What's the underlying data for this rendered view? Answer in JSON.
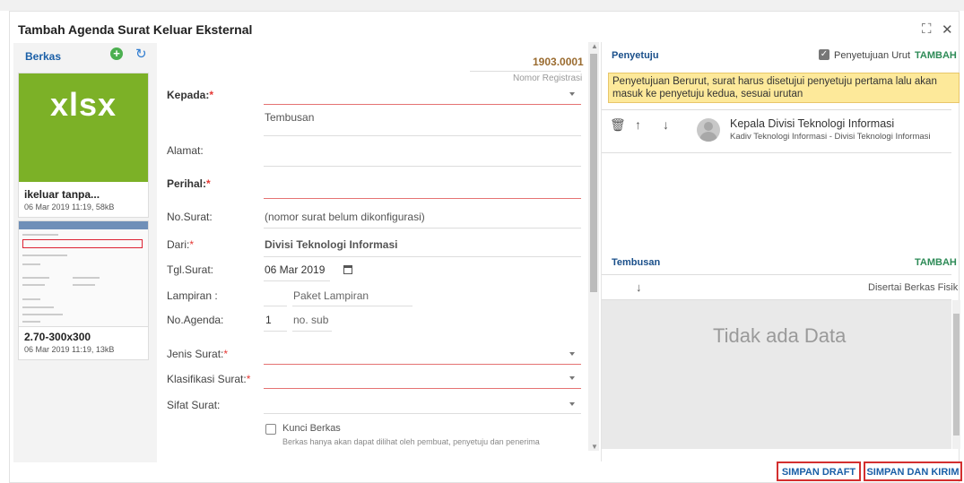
{
  "dialog": {
    "title": "Tambah Agenda Surat Keluar Eksternal",
    "expand_icon": "expand-icon",
    "close_icon": "close-icon"
  },
  "berkas": {
    "title": "Berkas",
    "files": [
      {
        "thumb_text": "xlsx",
        "name": "ikeluar tanpa...",
        "meta": "06 Mar 2019 11:19, 58kB"
      },
      {
        "thumb_text": "",
        "name": "2.70-300x300",
        "meta": "06 Mar 2019 11:19, 13kB"
      }
    ]
  },
  "form": {
    "nomor_registrasi_value": "1903.0001",
    "nomor_registrasi_label": "Nomor Registrasi",
    "kepada_label": "Kepada:",
    "tembusan_placeholder": "Tembusan",
    "alamat_label": "Alamat:",
    "perihal_label": "Perihal:",
    "no_surat_label": "No.Surat:",
    "no_surat_value": "(nomor surat belum dikonfigurasi)",
    "dari_label": "Dari:",
    "dari_value": "Divisi Teknologi Informasi",
    "tgl_surat_label": "Tgl.Surat:",
    "tgl_surat_value": "06 Mar 2019",
    "lampiran_label": "Lampiran :",
    "lampiran_placeholder": "Paket Lampiran",
    "no_agenda_label": "No.Agenda:",
    "no_agenda_value": "1",
    "no_sub_placeholder": "no. sub",
    "jenis_surat_label": "Jenis Surat:",
    "klasifikasi_label": "Klasifikasi Surat:",
    "sifat_surat_label": "Sifat Surat:",
    "kunci_berkas_label": "Kunci Berkas",
    "kunci_berkas_hint": "Berkas hanya akan dapat dilihat oleh pembuat, penyetuju dan penerima",
    "required_mark": "*"
  },
  "penyetuju": {
    "title": "Penyetuju",
    "urut_label": "Penyetujuan Urut",
    "urut_checked": true,
    "tambah_label": "TAMBAH",
    "note": "Penyetujuan Berurut, surat harus disetujui penyetuju pertama lalu akan masuk ke penyetuju kedua, sesuai urutan",
    "items": [
      {
        "name": "Kepala Divisi Teknologi Informasi",
        "role": "Kadiv Teknologi Informasi - Divisi Teknologi Informasi"
      }
    ]
  },
  "tembusan": {
    "title": "Tembusan",
    "tambah_label": "TAMBAH",
    "col_disertai": "Disertai Berkas Fisik",
    "empty_text": "Tidak ada Data"
  },
  "actions": {
    "simpan_draft": "SIMPAN DRAFT",
    "simpan_kirim": "SIMPAN DAN KIRIM"
  },
  "colors": {
    "accent_blue": "#1a5fa7",
    "required_red": "#e53935",
    "tambah_green": "#2e8b57",
    "note_yellow": "#fde99a",
    "xlsx_green": "#7cb127"
  }
}
